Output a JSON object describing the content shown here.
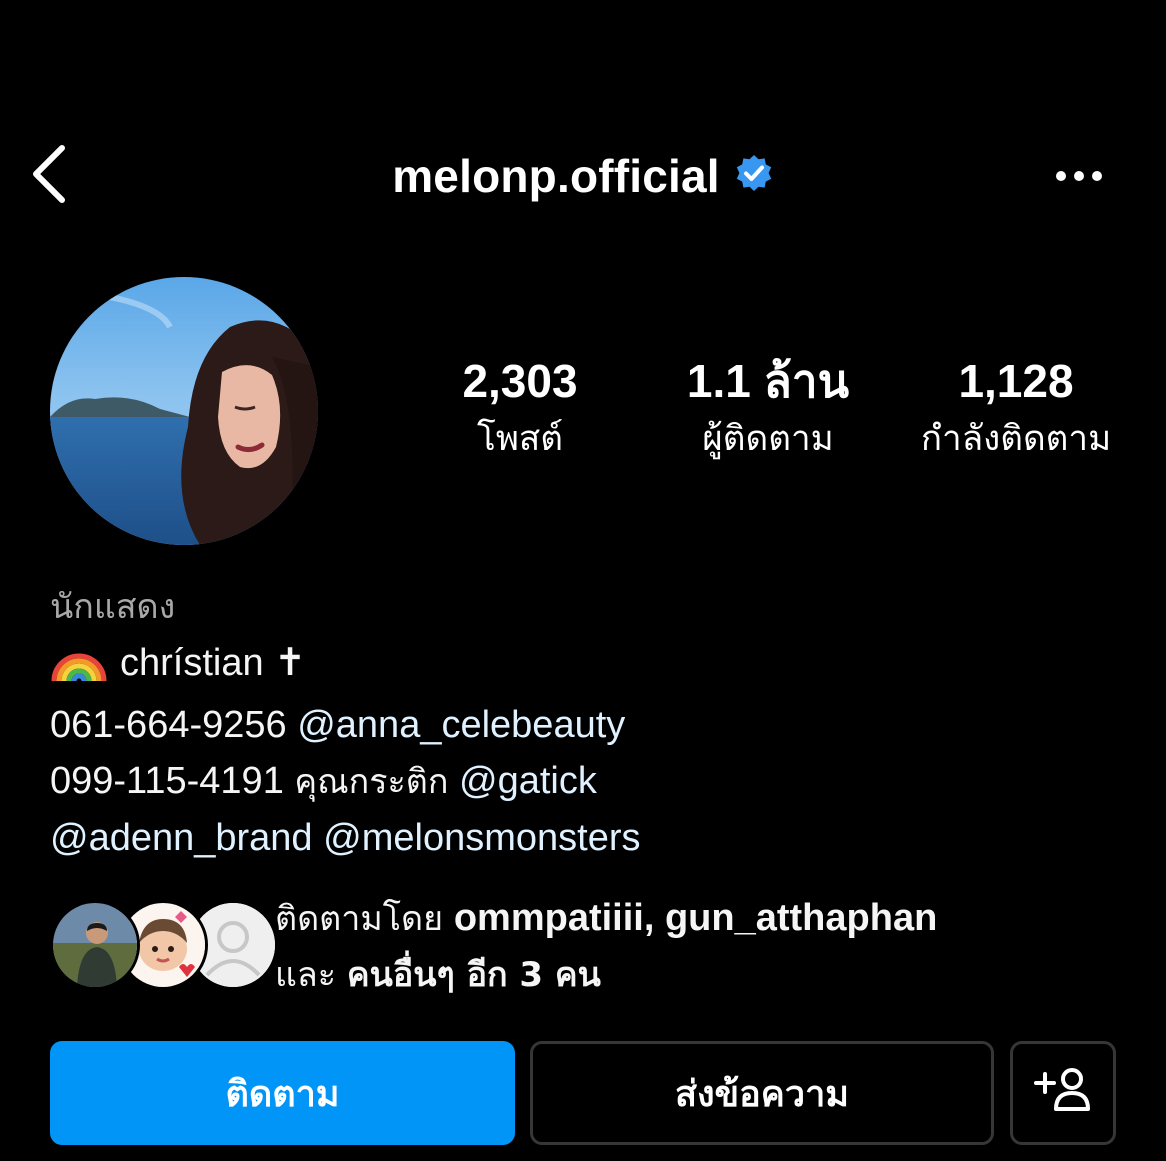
{
  "header": {
    "username": "melonp.official",
    "back_icon": "chevron-left-icon",
    "verified_icon": "verified-badge-icon",
    "more_icon": "more-horizontal-icon"
  },
  "stats": [
    {
      "value": "2,303",
      "label": "โพสต์"
    },
    {
      "value": "1.1 ล้าน",
      "label": "ผู้ติดตาม"
    },
    {
      "value": "1,128",
      "label": "กำลังติดตาม"
    }
  ],
  "bio": {
    "category": "นักแสดง",
    "line1_emoji": "🌈",
    "line1_text": "chrístian ✝",
    "line2_phone": "061-664-9256",
    "line2_mention": "@anna_celebeauty",
    "line3_phone": "099-115-4191",
    "line3_text": "คุณกระติก",
    "line3_mention": "@gatick",
    "line4_mention1": "@adenn_brand",
    "line4_mention2": "@melonsmonsters"
  },
  "followed_by": {
    "prefix": "ติดตามโดย",
    "names": "ommpatiiii, gun_atthaphan",
    "and": "และ",
    "others": "คนอื่นๆ อีก 3 คน"
  },
  "buttons": {
    "follow": "ติดตาม",
    "message": "ส่งข้อความ",
    "add_user_icon": "add-user-icon"
  },
  "colors": {
    "background": "#000000",
    "follow_button": "#0095f6",
    "verified_badge": "#3897f0",
    "link_text": "#e0f1ff",
    "category_text": "#a8a8a8",
    "button_border": "#363636"
  }
}
